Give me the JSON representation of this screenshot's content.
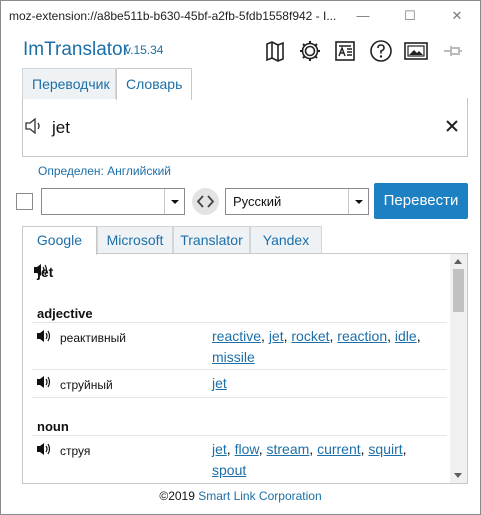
{
  "window": {
    "title": "moz-extension://a8be511b-b630-45bf-a2fb-5fdb1558f942 - I...",
    "min_glyph": "—",
    "max_glyph": "☐",
    "close_glyph": "✕"
  },
  "header": {
    "brand": "ImTranslator",
    "version": "v.15.34",
    "icons": [
      "map-icon",
      "gear-icon",
      "font-icon",
      "help-icon",
      "image-icon",
      "pin-icon"
    ]
  },
  "top_tabs": [
    {
      "label": "Переводчик",
      "active": false
    },
    {
      "label": "Словарь",
      "active": true
    }
  ],
  "input": {
    "text": "jet"
  },
  "detected_language": "Определен: Английский",
  "languages": {
    "source": "",
    "target": "Русский"
  },
  "translate_button": "Перевести",
  "result_tabs": [
    {
      "label": "Google",
      "active": true
    },
    {
      "label": "Microsoft",
      "active": false
    },
    {
      "label": "Translator",
      "active": false
    },
    {
      "label": "Yandex",
      "active": false
    }
  ],
  "dictionary": {
    "word": "jet",
    "groups": [
      {
        "pos": "adjective",
        "entries": [
          {
            "term": "реактивный",
            "synonyms": [
              "reactive",
              "jet",
              "rocket",
              "reaction",
              "idle",
              "missile"
            ]
          },
          {
            "term": "струйный",
            "synonyms": [
              "jet"
            ]
          }
        ]
      },
      {
        "pos": "noun",
        "entries": [
          {
            "term": "струя",
            "synonyms": [
              "jet",
              "flow",
              "stream",
              "current",
              "squirt",
              "spout"
            ]
          }
        ]
      }
    ]
  },
  "footer": {
    "copyright": "©2019",
    "company": "Smart Link Corporation"
  },
  "colors": {
    "accent": "#1c6fa8",
    "button": "#1c80c3"
  }
}
